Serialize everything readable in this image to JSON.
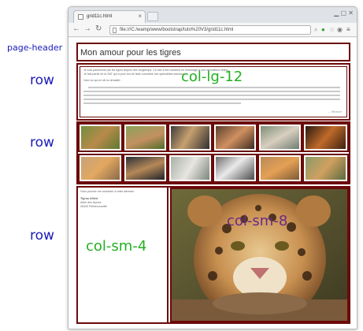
{
  "annotations": {
    "page_header": "page-header",
    "row_1": "row",
    "row_2": "row",
    "row_3": "row"
  },
  "browser": {
    "tab_title": "grid11c.html",
    "url": "file:///C:/wamp/www/bootstrap/tuto%20V3/grid11c.html"
  },
  "page": {
    "header_title": "Mon amour pour les tigres",
    "intro_line_1": "Je suis passionné par les tigres depuis très longtemps. Ce site a été construit en hommage à ces merveilleux félins...",
    "intro_line_2": "Je fais partie de la SAT qui a pour but de faire connaître ces splendides animaux.",
    "intro_line_3": "Voici un qui en dit la virtualité :",
    "col_lg_label": "col-lg-12",
    "signature": "-- Hibeize"
  },
  "row3": {
    "contact_line": "Vous pouvez me contacter à cette adresse :",
    "name": "Tigrou Alfred",
    "street": "Allée des fauves",
    "city": "26440 Félinecourville",
    "col_sm_4_label": "col-sm-4",
    "col_sm_8_label": "col-sm-8"
  },
  "colors": {
    "border": "#6b0a0a",
    "annotation_blue": "#1a1ab8",
    "label_green": "#22b022",
    "label_purple": "#6a2a8a"
  }
}
